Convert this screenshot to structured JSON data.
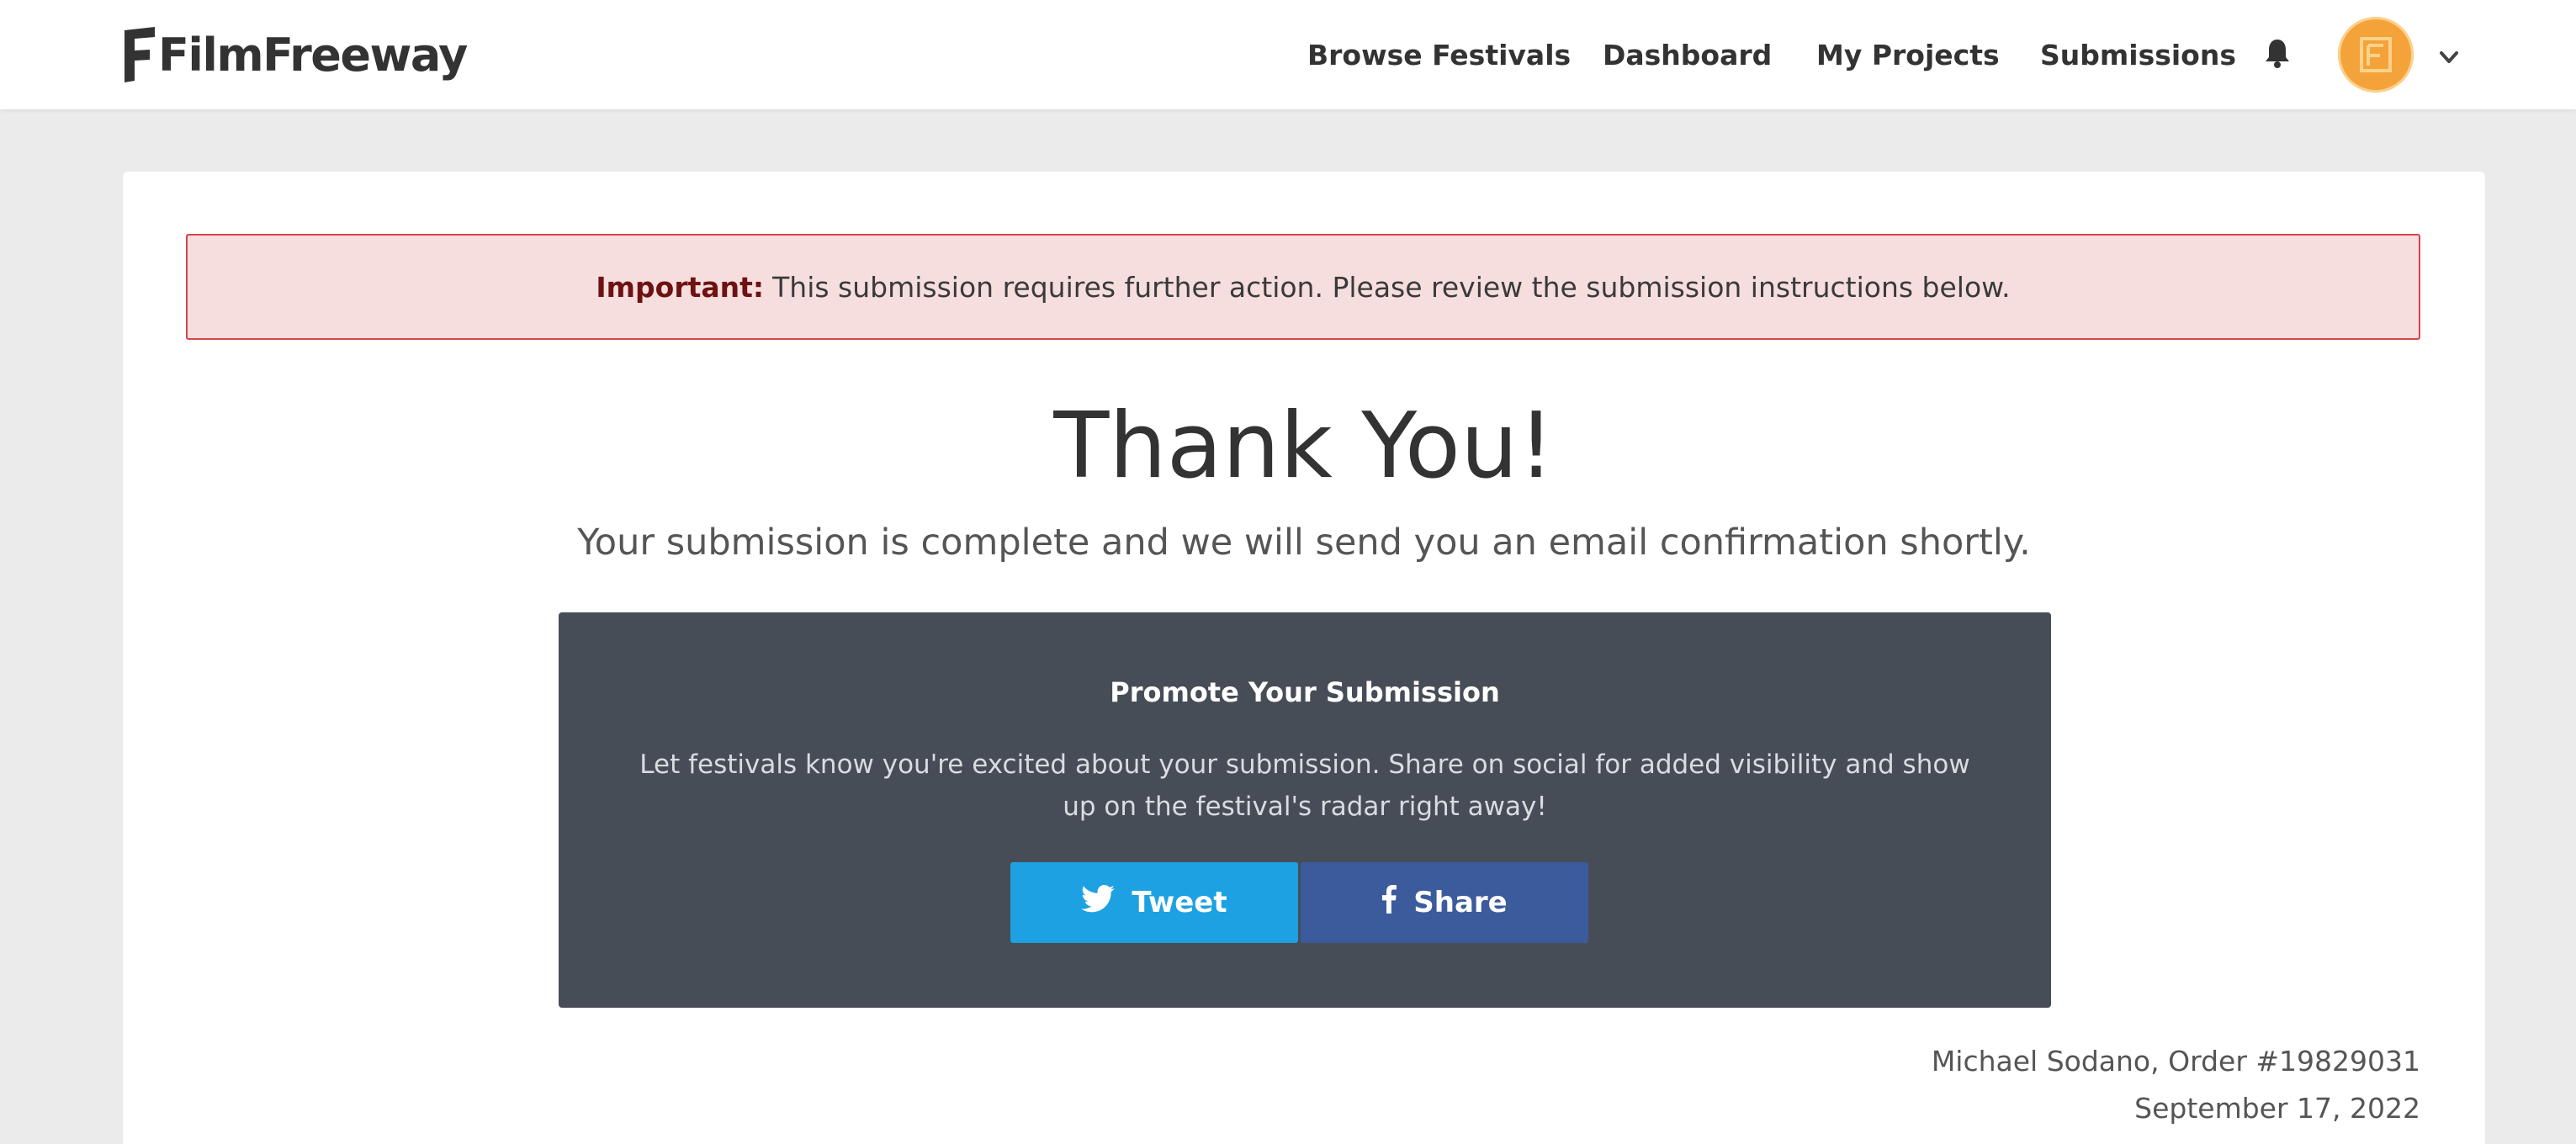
{
  "header": {
    "logo_text": "FilmFreeway",
    "nav": [
      {
        "label": "Browse Festivals"
      },
      {
        "label": "Dashboard"
      },
      {
        "label": "My Projects"
      },
      {
        "label": "Submissions"
      }
    ],
    "icons": [
      "bell-icon",
      "avatar",
      "chevron-down-icon"
    ]
  },
  "alert": {
    "label": "Important:",
    "message": "This submission requires further action. Please review the submission instructions below."
  },
  "confirmation": {
    "title": "Thank You!",
    "subtitle": "Your submission is complete and we will send you an email confirmation shortly."
  },
  "promote": {
    "title": "Promote Your Submission",
    "body_line1": "Let festivals know you're excited about your submission. Share on social for added visibility and show",
    "body_line2": "up on the festival's radar right away!",
    "tweet_label": "Tweet",
    "share_label": "Share"
  },
  "order": {
    "line": "Michael Sodano, Order #19829031",
    "date": "September 17, 2022"
  },
  "colors": {
    "alert_bg": "#f7dede",
    "alert_border": "#d9434a",
    "promo_bg": "#474d57",
    "twitter": "#1da1e2",
    "facebook": "#3b5b9c",
    "avatar": "#f3a33a"
  }
}
